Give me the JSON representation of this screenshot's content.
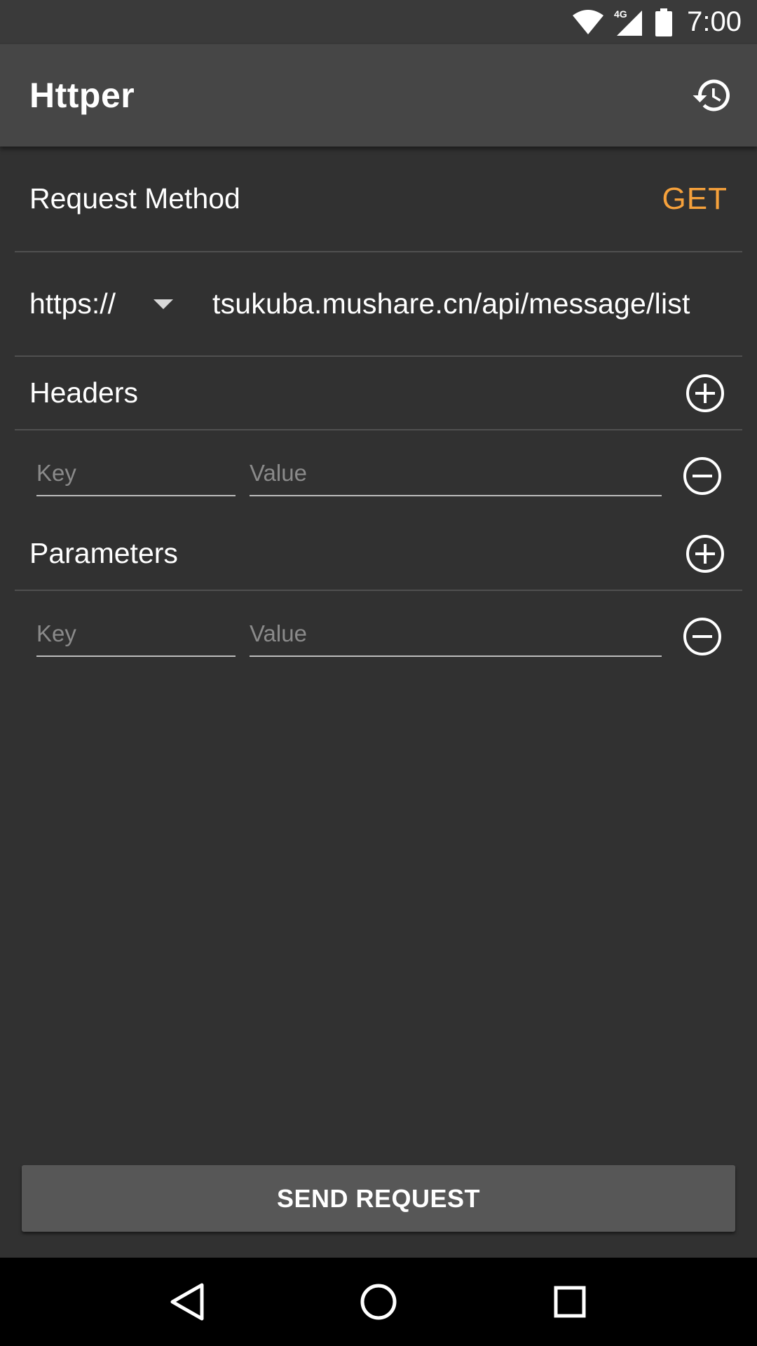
{
  "status_bar": {
    "time": "7:00",
    "network": "4G"
  },
  "app_bar": {
    "title": "Httper",
    "history_icon": "history-icon"
  },
  "request": {
    "method_label": "Request Method",
    "method_value": "GET",
    "protocol": "https://",
    "url": "tsukuba.mushare.cn/api/message/list"
  },
  "headers": {
    "title": "Headers",
    "rows": [
      {
        "key_placeholder": "Key",
        "value_placeholder": "Value"
      }
    ]
  },
  "parameters": {
    "title": "Parameters",
    "rows": [
      {
        "key_placeholder": "Key",
        "value_placeholder": "Value"
      }
    ]
  },
  "send_button": {
    "label": "SEND REQUEST"
  },
  "colors": {
    "background": "#313131",
    "app_bar": "#464646",
    "accent": "#f6a13b",
    "button": "#575757"
  }
}
